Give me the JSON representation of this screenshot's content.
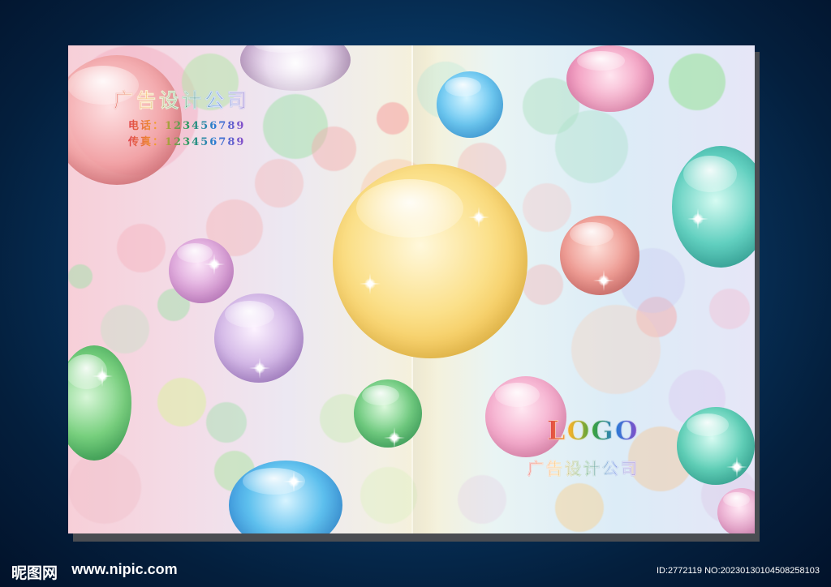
{
  "cover": {
    "company_name": "广告设计公司",
    "phone": "电话：123456789",
    "fax": "传真：123456789",
    "logo": "LOGO",
    "company_name_bottom": "广告设计公司"
  },
  "watermark": {
    "brand": "昵图网",
    "site": "www.nipic.com",
    "id": "ID:2772119 NO:20230130104508258103"
  },
  "colors": {
    "frame_background": "#083a67",
    "cover_shadow": "#4a4d52"
  }
}
